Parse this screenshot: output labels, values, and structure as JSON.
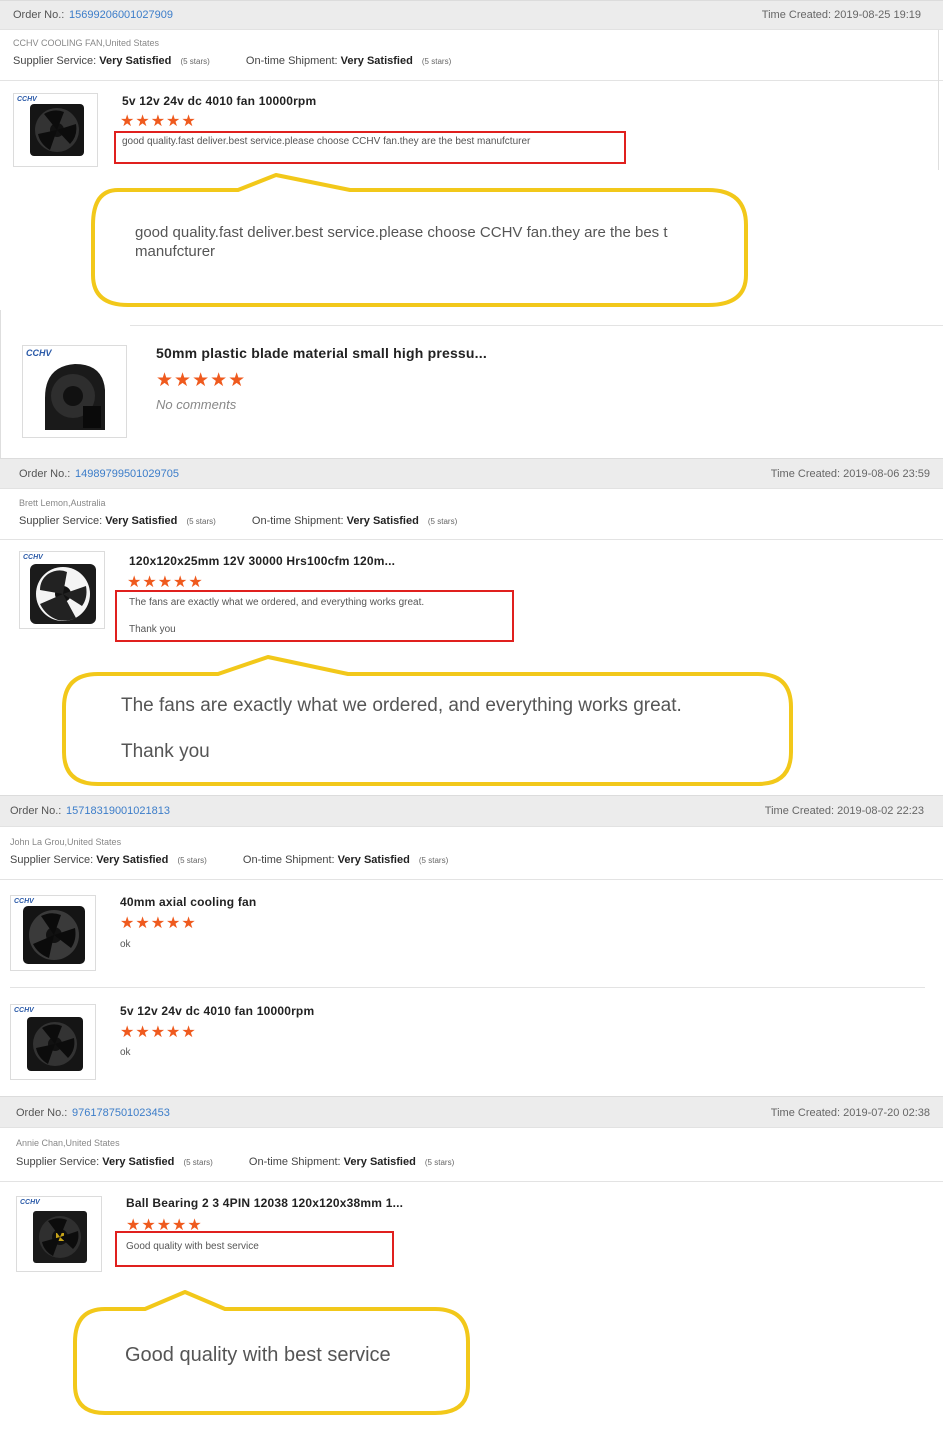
{
  "labels": {
    "order_no": "Order No.:",
    "time_created": "Time Created:",
    "supplier_service": "Supplier Service:",
    "ontime_shipment": "On-time Shipment:",
    "very_satisfied": "Very Satisfied",
    "five_stars": "(5 stars)",
    "no_comments": "No comments"
  },
  "stars": "★★★★★",
  "orders": [
    {
      "order_no": "15699206001027909",
      "time": "Time Created: 2019-08-25 19:19",
      "buyer": "CCHV COOLING FAN,United States",
      "items": [
        {
          "brand": "CCHV",
          "name": "5v 12v 24v dc 4010 fan 10000rpm",
          "comment": "good quality.fast deliver.best service.please choose CCHV fan.they are the best manufcturer",
          "callout": "good quality.fast deliver.best service.please choose CCHV fan.they are the bes t manufcturer"
        },
        {
          "brand": "CCHV",
          "name": "50mm plastic blade material small high pressu..."
        }
      ]
    },
    {
      "order_no": "14989799501029705",
      "time": "Time Created: 2019-08-06 23:59",
      "buyer": "Brett Lemon,Australia",
      "items": [
        {
          "brand": "CCHV",
          "name": "120x120x25mm 12V 30000 Hrs100cfm 120m...",
          "comment_line1": "The fans are exactly what we ordered, and everything works great.",
          "comment_line2": "Thank you",
          "callout_line1": "The fans are exactly what we ordered, and everything works great.",
          "callout_line2": "Thank you"
        }
      ]
    },
    {
      "order_no": "15718319001021813",
      "time": "Time Created: 2019-08-02 22:23",
      "buyer": "John La Grou,United States",
      "items": [
        {
          "brand": "CCHV",
          "name": "40mm axial cooling fan",
          "comment": "ok"
        },
        {
          "brand": "CCHV",
          "name": "5v 12v 24v dc 4010 fan 10000rpm",
          "comment": "ok"
        }
      ]
    },
    {
      "order_no": "9761787501023453",
      "time": "Time Created: 2019-07-20 02:38",
      "buyer": "Annie Chan,United States",
      "items": [
        {
          "brand": "CCHV",
          "name": "Ball Bearing 2 3 4PIN 12038 120x120x38mm 1...",
          "comment": "Good quality with best service",
          "callout": "Good quality with best service"
        }
      ]
    }
  ],
  "colors": {
    "link_blue": "#3c7dc9",
    "star_orange": "#ef5a1e",
    "red_outline": "#e0201e",
    "callout_yellow": "#f2c81a",
    "header_bar": "#ececec"
  }
}
